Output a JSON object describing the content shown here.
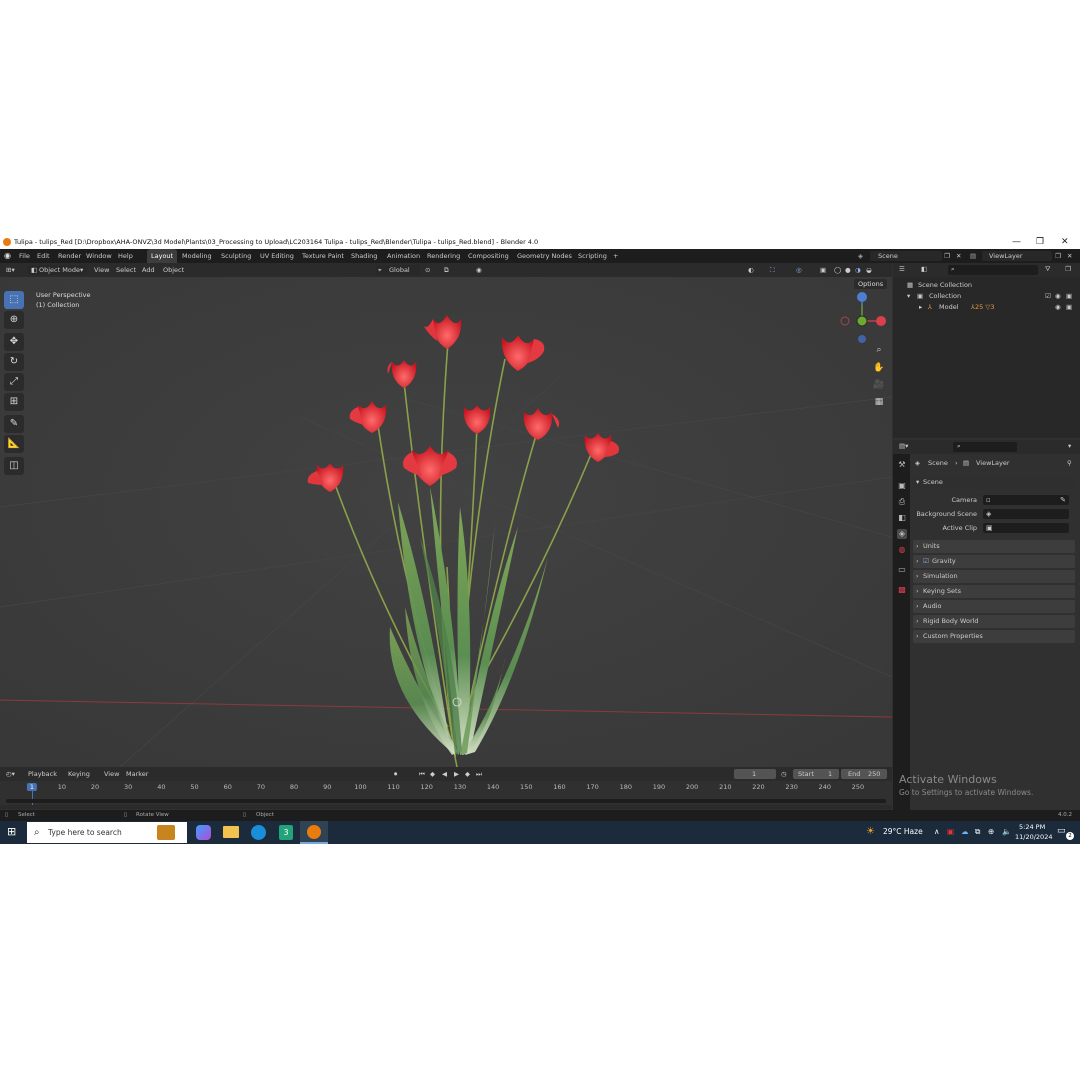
{
  "window": {
    "title": "Tulipa - tulips_Red [D:\\Dropbox\\AHA-ONVZ\\3d Model\\Plants\\03_Processing to Upload\\LC203164 Tulipa - tulips_Red\\Blender\\Tulipa - tulips_Red.blend] - Blender 4.0",
    "minimize": "—",
    "maximize": "❐",
    "close": "✕"
  },
  "menu": {
    "file": "File",
    "edit": "Edit",
    "render": "Render",
    "window": "Window",
    "help": "Help"
  },
  "workspaces": [
    "Layout",
    "Modeling",
    "Sculpting",
    "UV Editing",
    "Texture Paint",
    "Shading",
    "Animation",
    "Rendering",
    "Compositing",
    "Geometry Nodes",
    "Scripting",
    "+"
  ],
  "top_right": {
    "scene": "Scene",
    "view_layer": "ViewLayer"
  },
  "header3d": {
    "mode": "Object Mode",
    "view": "View",
    "select": "Select",
    "add": "Add",
    "object": "Object",
    "transform": "Global",
    "options": "Options"
  },
  "viewport": {
    "perspective": "User Perspective",
    "collection": "(1) Collection"
  },
  "gizmo": {
    "x": "X",
    "y": "Y",
    "z": "Z"
  },
  "outliner": {
    "scene_collection": "Scene Collection",
    "collection": "Collection",
    "model": "Model",
    "model_badge": "25",
    "model_badge2": "3"
  },
  "properties": {
    "breadcrumb_scene": "Scene",
    "breadcrumb_layer": "ViewLayer",
    "panel_scene": "Scene",
    "camera_label": "Camera",
    "background_label": "Background Scene",
    "clip_label": "Active Clip",
    "panels": [
      "Units",
      "Gravity",
      "Simulation",
      "Keying Sets",
      "Audio",
      "Rigid Body World",
      "Custom Properties"
    ]
  },
  "timeline": {
    "playback": "Playback",
    "keying": "Keying",
    "view": "View",
    "marker": "Marker",
    "current_frame": "1",
    "start_label": "Start",
    "start": "1",
    "end_label": "End",
    "end": "250",
    "ticks": [
      "1",
      "10",
      "20",
      "30",
      "40",
      "50",
      "60",
      "70",
      "80",
      "90",
      "100",
      "110",
      "120",
      "130",
      "140",
      "150",
      "160",
      "170",
      "180",
      "190",
      "200",
      "210",
      "220",
      "230",
      "240",
      "250"
    ]
  },
  "statusbar": {
    "select": "Select",
    "rotate": "Rotate View",
    "object": "Object",
    "version": "4.0.2"
  },
  "activation": {
    "title": "Activate Windows",
    "subtitle": "Go to Settings to activate Windows."
  },
  "taskbar": {
    "search_placeholder": "Type here to search",
    "weather": "29°C  Haze",
    "time": "5:24 PM",
    "date": "11/20/2024",
    "notifications": "2"
  },
  "colors": {
    "accent": "#4772b3",
    "blender_orange": "#e87d0d",
    "tulip_red": "#d8262e",
    "stem_green": "#6f8b3f"
  }
}
